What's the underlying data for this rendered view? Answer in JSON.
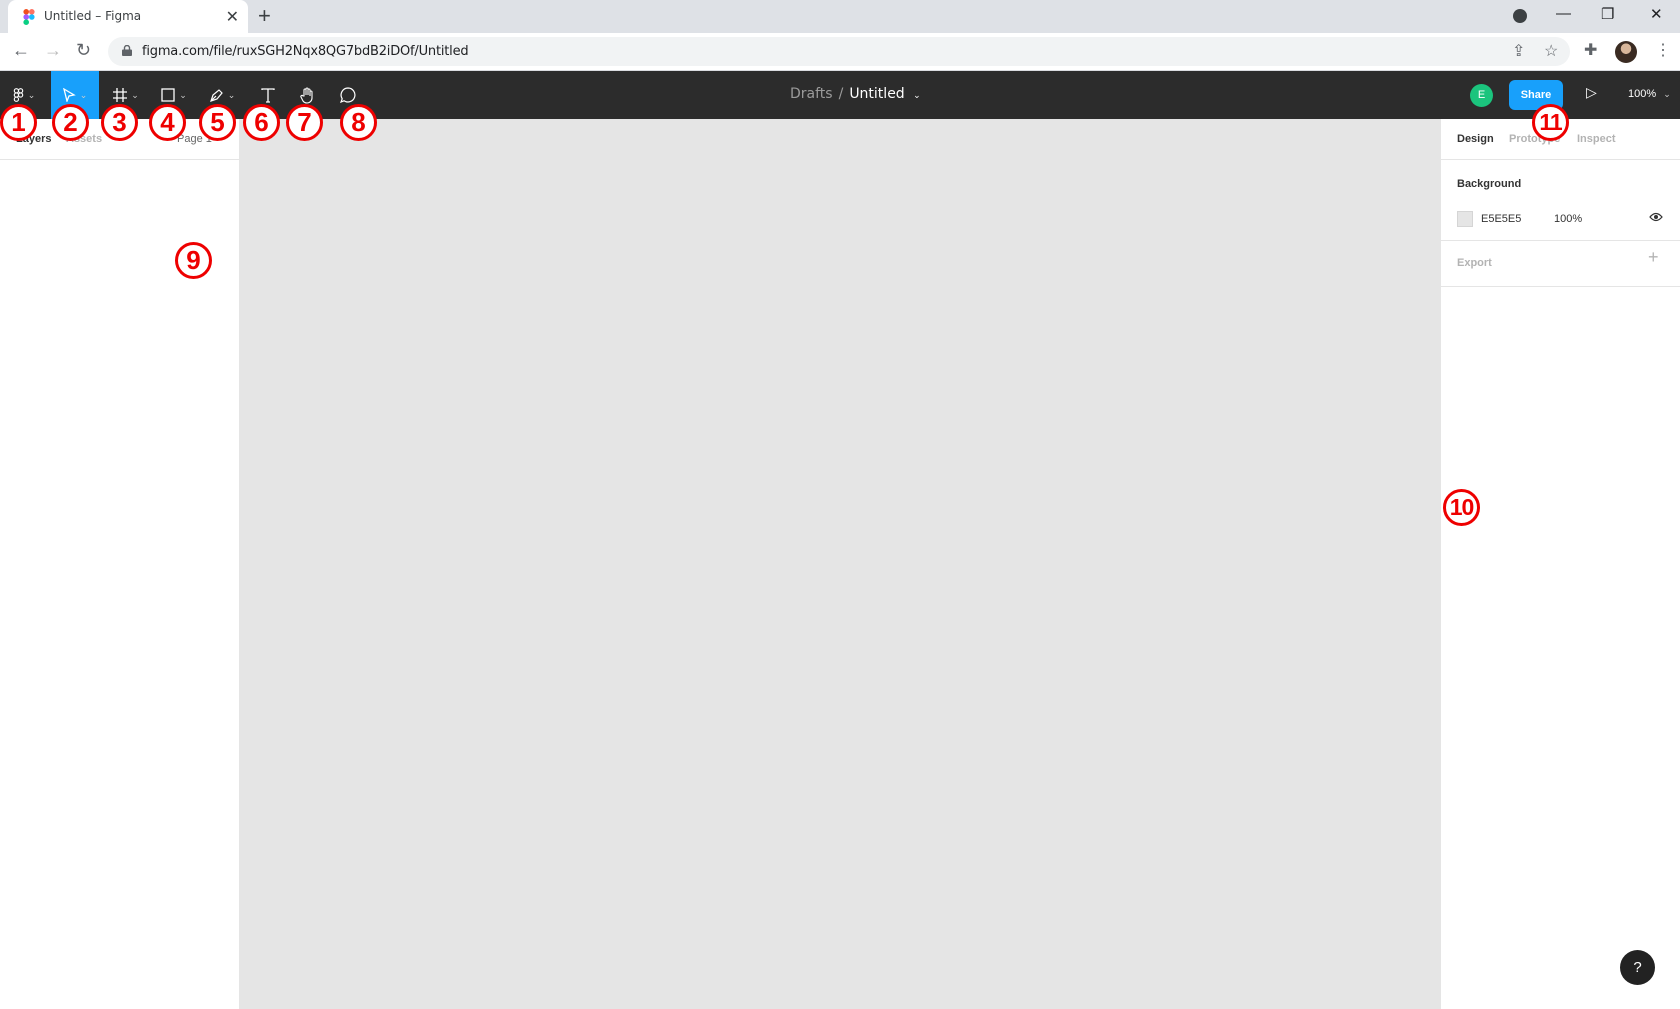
{
  "browser": {
    "tab_title": "Untitled – Figma",
    "url": "figma.com/file/ruxSGH2Nqx8QG7bdB2iDOf/Untitled"
  },
  "figma": {
    "breadcrumb_drafts": "Drafts",
    "breadcrumb_sep": "/",
    "file_name": "Untitled",
    "user_initial": "E",
    "share_label": "Share",
    "zoom_label": "100%",
    "left_tabs": [
      "Layers",
      "Assets"
    ],
    "page_label": "Page 1",
    "right_tabs": [
      "Design",
      "Prototype",
      "Inspect"
    ],
    "background_title": "Background",
    "background_hex": "E5E5E5",
    "background_opacity": "100%",
    "export_title": "Export",
    "help_label": "?"
  },
  "markers": [
    "1",
    "2",
    "3",
    "4",
    "5",
    "6",
    "7",
    "8",
    "9",
    "10",
    "11"
  ],
  "colors": {
    "accent": "#18a0fb",
    "topbar": "#2c2c2c",
    "canvas": "#e5e5e5",
    "marker": "#ee0000",
    "user_badge": "#1bc47d"
  }
}
